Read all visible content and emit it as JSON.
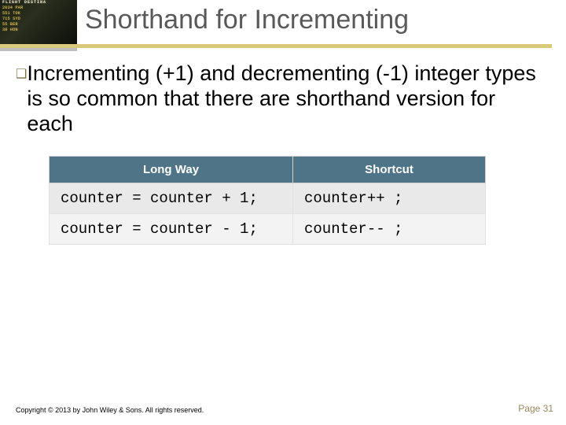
{
  "title": "Shorthand for Incrementing",
  "bullet_marker": "❑",
  "bullet": "Incrementing (+1) and decrementing (-1) integer types is so common that there are shorthand version for each",
  "table": {
    "headers": {
      "long": "Long Way",
      "short": "Shortcut"
    },
    "rows": [
      {
        "long": "counter = counter + 1;",
        "short": "counter++ ;"
      },
      {
        "long": "counter = counter - 1;",
        "short": "counter-- ;"
      }
    ]
  },
  "board": {
    "header": "FLIGHT   DESTINA",
    "rows": [
      "2034  PAR",
      "551   TOK",
      "715   SYD",
      "55    BER",
      "38    HON"
    ]
  },
  "footer": {
    "copyright": "Copyright © 2013 by John Wiley & Sons. All rights reserved.",
    "page": "Page 31"
  }
}
